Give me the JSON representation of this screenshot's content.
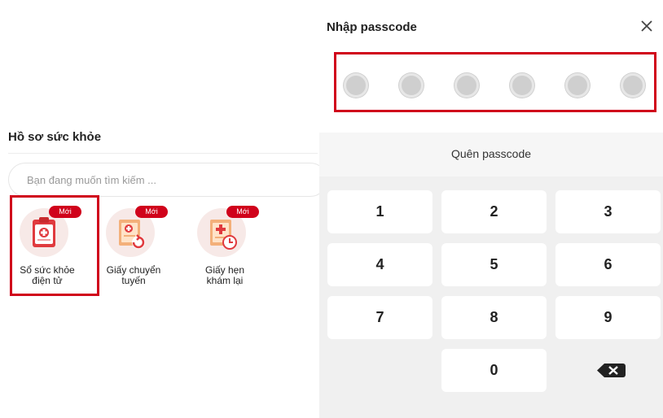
{
  "health_records": {
    "title": "Hồ sơ sức khỏe",
    "search_placeholder": "Bạn đang muốn tìm kiếm ...",
    "tiles": [
      {
        "label_line1": "Sổ sức khỏe",
        "label_line2": "điện tử",
        "badge": "Mới",
        "icon": "health-book-icon"
      },
      {
        "label_line1": "Giấy chuyển",
        "label_line2": "tuyến",
        "badge": "Mới",
        "icon": "referral-letter-icon"
      },
      {
        "label_line1": "Giấy hẹn",
        "label_line2": "khám lại",
        "badge": "Mới",
        "icon": "appointment-paper-icon"
      }
    ]
  },
  "passcode": {
    "title": "Nhập passcode",
    "forgot_label": "Quên passcode",
    "keys": [
      "1",
      "2",
      "3",
      "4",
      "5",
      "6",
      "7",
      "8",
      "9",
      "0"
    ],
    "dots_count": 6,
    "close_icon": "close-icon",
    "backspace_icon": "backspace-icon"
  },
  "colors": {
    "accent": "#d0021b",
    "dot": "#cfcfcf",
    "keypad_bg": "#f0f0f0"
  }
}
